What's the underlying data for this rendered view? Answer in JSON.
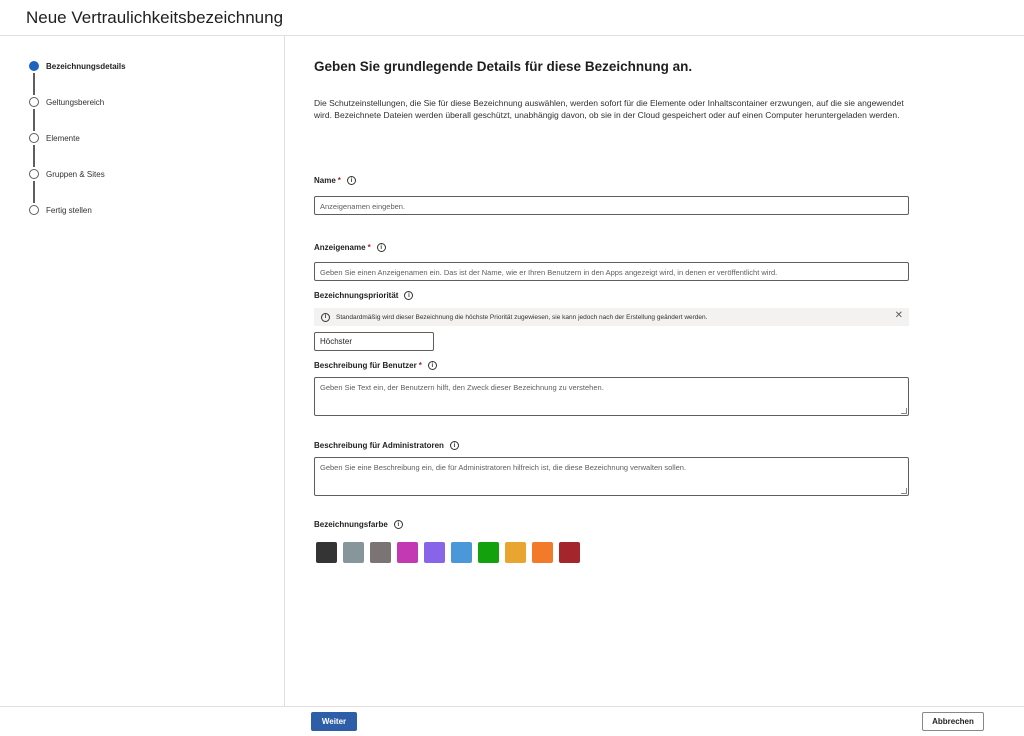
{
  "window": {
    "title": "Neue Vertraulichkeitsbezeichnung"
  },
  "steps": [
    {
      "label": "Bezeichnungsdetails",
      "active": true
    },
    {
      "label": "Geltungsbereich",
      "active": false
    },
    {
      "label": "Elemente",
      "active": false
    },
    {
      "label": "Gruppen & Sites",
      "active": false
    },
    {
      "label": "Fertig stellen",
      "active": false
    }
  ],
  "main": {
    "title": "Geben Sie grundlegende Details für diese Bezeichnung an.",
    "intro": "Die Schutzeinstellungen, die Sie für diese Bezeichnung auswählen, werden sofort für die Elemente oder Inhaltscontainer erzwungen, auf die sie angewendet wird. Bezeichnete Dateien werden überall geschützt, unabhängig davon, ob sie in der Cloud gespeichert oder auf einen Computer heruntergeladen werden."
  },
  "fields": {
    "name": {
      "label": "Name",
      "required": "*",
      "placeholder": "Anzeigenamen eingeben."
    },
    "display_name": {
      "label": "Anzeigename",
      "required": "*",
      "placeholder": "Geben Sie einen Anzeigenamen ein. Das ist der Name, wie er Ihren Benutzern in den Apps angezeigt wird, in denen er veröffentlicht wird."
    },
    "priority": {
      "label": "Bezeichnungspriorität",
      "info": "Standardmäßig wird dieser Bezeichnung die höchste Priorität zugewiesen, sie kann jedoch nach der Erstellung geändert werden.",
      "value": "Höchster"
    },
    "user_description": {
      "label": "Beschreibung für Benutzer",
      "required": "*",
      "placeholder": "Geben Sie Text ein, der Benutzern hilft, den Zweck dieser Bezeichnung zu verstehen."
    },
    "admin_description": {
      "label": "Beschreibung für Administratoren",
      "placeholder": "Geben Sie eine Beschreibung ein, die für Administratoren hilfreich ist, die diese Bezeichnung verwalten sollen."
    },
    "color": {
      "label": "Bezeichnungsfarbe"
    }
  },
  "colors": [
    "#343434",
    "#87969a",
    "#7a7574",
    "#c239b3",
    "#8764e8",
    "#4a98da",
    "#13a10e",
    "#e8a530",
    "#f37a2b",
    "#a4262c"
  ],
  "icons": {
    "info": "info-icon",
    "close": "close-icon"
  },
  "footer": {
    "next": "Weiter",
    "cancel": "Abbrechen"
  }
}
